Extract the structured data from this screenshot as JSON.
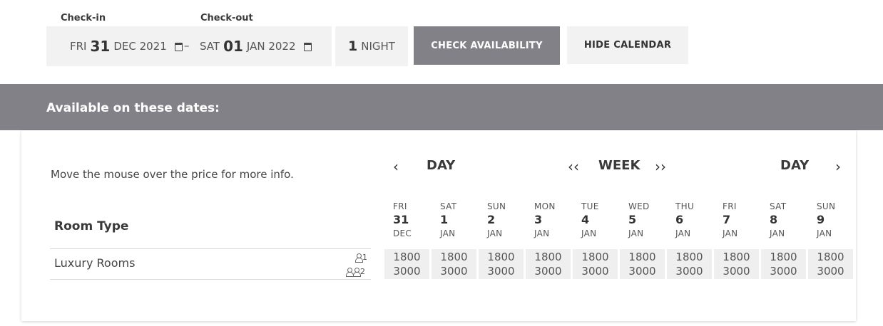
{
  "search": {
    "checkin_label": "Check-in",
    "checkout_label": "Check-out",
    "checkin": {
      "dow": "FRI",
      "day": "31",
      "monthyear": "DEC 2021"
    },
    "checkout": {
      "dow": "SAT",
      "day": "01",
      "monthyear": "JAN 2022"
    },
    "separator": "–",
    "nights_count": "1",
    "nights_label": "NIGHT",
    "check_button": "CHECK AVAILABILITY",
    "hide_button": "HIDE CALENDAR"
  },
  "banner": {
    "title": "Available on these dates:"
  },
  "calendar": {
    "hint": "Move the mouse over the price for more info.",
    "room_type_header": "Room Type",
    "nav": {
      "prev_day": "‹",
      "day_left": "DAY",
      "prev_week": "‹‹",
      "week": "WEEK",
      "next_week": "››",
      "day_right": "DAY",
      "next_day": "›"
    },
    "days": [
      {
        "dow": "FRI",
        "num": "31",
        "mon": "DEC"
      },
      {
        "dow": "SAT",
        "num": "1",
        "mon": "JAN"
      },
      {
        "dow": "SUN",
        "num": "2",
        "mon": "JAN"
      },
      {
        "dow": "MON",
        "num": "3",
        "mon": "JAN"
      },
      {
        "dow": "TUE",
        "num": "4",
        "mon": "JAN"
      },
      {
        "dow": "WED",
        "num": "5",
        "mon": "JAN"
      },
      {
        "dow": "THU",
        "num": "6",
        "mon": "JAN"
      },
      {
        "dow": "FRI",
        "num": "7",
        "mon": "JAN"
      },
      {
        "dow": "SAT",
        "num": "8",
        "mon": "JAN"
      },
      {
        "dow": "SUN",
        "num": "9",
        "mon": "JAN"
      }
    ],
    "rooms": [
      {
        "name": "Luxury Rooms",
        "occupancy_1": "1",
        "occupancy_2": "2",
        "prices": [
          {
            "single": "1800",
            "double": "3000"
          },
          {
            "single": "1800",
            "double": "3000"
          },
          {
            "single": "1800",
            "double": "3000"
          },
          {
            "single": "1800",
            "double": "3000"
          },
          {
            "single": "1800",
            "double": "3000"
          },
          {
            "single": "1800",
            "double": "3000"
          },
          {
            "single": "1800",
            "double": "3000"
          },
          {
            "single": "1800",
            "double": "3000"
          },
          {
            "single": "1800",
            "double": "3000"
          },
          {
            "single": "1800",
            "double": "3000"
          }
        ]
      }
    ]
  },
  "icons": [
    "calendar-icon",
    "person-icon",
    "persons-icon",
    "chevron-left-icon",
    "chevron-right-icon",
    "double-chevron-left-icon",
    "double-chevron-right-icon"
  ]
}
